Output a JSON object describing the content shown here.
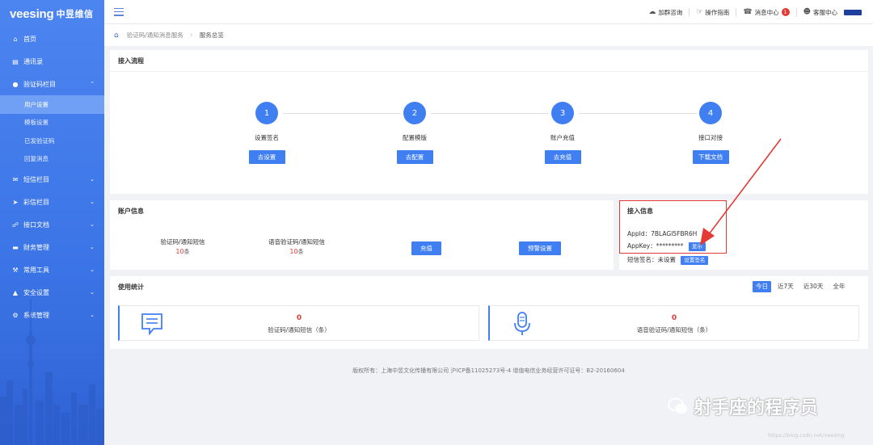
{
  "logo": {
    "brand": "veesing",
    "brand_cn": "中昱维信"
  },
  "sidebar": {
    "items": [
      {
        "label": "首页",
        "icon": "home-icon"
      },
      {
        "label": "通讯录",
        "icon": "address-book-icon"
      },
      {
        "label": "验证码栏目",
        "icon": "chat-icon",
        "expanded": true,
        "children": [
          "用户设置",
          "模板设置",
          "已发验证码",
          "回复消息"
        ]
      },
      {
        "label": "短信栏目",
        "icon": "mail-icon"
      },
      {
        "label": "彩信栏目",
        "icon": "send-icon"
      },
      {
        "label": "接口文档",
        "icon": "network-icon"
      },
      {
        "label": "财务管理",
        "icon": "card-icon"
      },
      {
        "label": "常用工具",
        "icon": "wrench-icon"
      },
      {
        "label": "安全设置",
        "icon": "warning-icon"
      },
      {
        "label": "系统管理",
        "icon": "gear-icon"
      }
    ],
    "active_child": "用户设置"
  },
  "topbar": {
    "consult": "加群咨询",
    "guide": "操作指南",
    "messages": "消息中心",
    "messages_badge": "1",
    "service": "客服中心"
  },
  "breadcrumb": {
    "parent": "验证码/通知消息服务",
    "current": "服务总览"
  },
  "flow": {
    "title": "接入流程",
    "steps": [
      {
        "num": "1",
        "label": "设置签名",
        "button": "去设置"
      },
      {
        "num": "2",
        "label": "配置模版",
        "button": "去配置"
      },
      {
        "num": "3",
        "label": "账户充值",
        "button": "去充值"
      },
      {
        "num": "4",
        "label": "接口对接",
        "button": "下载文档"
      }
    ]
  },
  "account": {
    "title": "账户信息",
    "sms_label": "验证码/通知短信",
    "sms_count": "10",
    "sms_unit": "条",
    "voice_label": "语音验证码/通知短信",
    "voice_count": "10",
    "voice_unit": "条",
    "recharge_button": "充值",
    "alert_button": "预警设置"
  },
  "access": {
    "title": "接入信息",
    "appid_label": "AppId：",
    "appid_value": "7BLAGI5FBR6H",
    "appkey_label": "AppKey：",
    "appkey_value": "*********",
    "show_button": "显示",
    "sign_label": "短信签名：未设置",
    "sign_button": "设置签名"
  },
  "usage": {
    "title": "使用统计",
    "ranges": [
      "今日",
      "近7天",
      "近30天",
      "全年"
    ],
    "active_range": "今日",
    "boxes": [
      {
        "value": "0",
        "label": "验证码/通知短信（条）",
        "icon": "message-icon"
      },
      {
        "value": "0",
        "label": "语音验证码/通知短信（条）",
        "icon": "microphone-icon"
      }
    ]
  },
  "footer": {
    "text": "版权所有：上海中昱文化传播有限公司 沪ICP备11025273号-4 增值电信业务经营许可证号：B2-20160604"
  },
  "watermark": {
    "text": "射手座的程序员",
    "url": "https://blog.csdn.net/veesing"
  },
  "colors": {
    "primary": "#3f7ff2",
    "sidebar": "#4c85f0",
    "danger": "#e53935"
  }
}
